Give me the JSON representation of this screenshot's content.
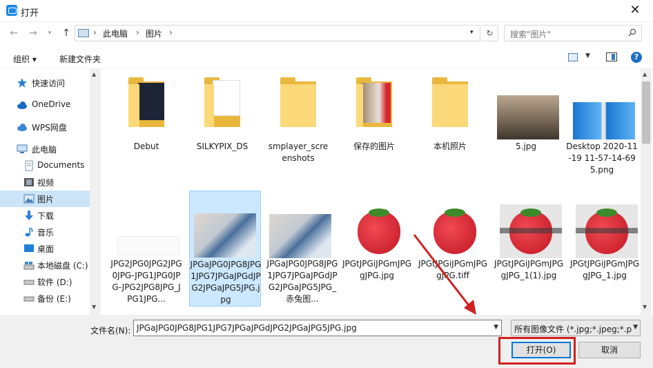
{
  "window": {
    "title": "打开"
  },
  "address": {
    "crumbs": [
      "此电脑",
      "图片"
    ],
    "search_placeholder": "搜索\"图片\""
  },
  "toolbar": {
    "organize": "组织 ▾",
    "new_folder": "新建文件夹"
  },
  "nav": {
    "items": [
      {
        "label": "快速访问",
        "icon": "star-icon"
      },
      {
        "label": "OneDrive",
        "icon": "cloud-icon"
      },
      {
        "label": "WPS网盘",
        "icon": "cloud-icon"
      },
      {
        "label": "此电脑",
        "icon": "computer-icon"
      },
      {
        "label": "Documents",
        "icon": "document-icon"
      },
      {
        "label": "视频",
        "icon": "video-icon"
      },
      {
        "label": "图片",
        "icon": "picture-icon"
      },
      {
        "label": "下载",
        "icon": "download-icon"
      },
      {
        "label": "音乐",
        "icon": "music-icon"
      },
      {
        "label": "桌面",
        "icon": "desktop-icon"
      },
      {
        "label": "本地磁盘 (C:)",
        "icon": "drive-icon"
      },
      {
        "label": "软件 (D:)",
        "icon": "drive-icon"
      },
      {
        "label": "备份 (E:)",
        "icon": "drive-icon"
      }
    ],
    "selected_index": 6
  },
  "files": {
    "row1": [
      {
        "label": "Debut",
        "kind": "folder"
      },
      {
        "label": "SILKYPIX_DS",
        "kind": "folder"
      },
      {
        "label": "smplayer_screenshots",
        "kind": "folder"
      },
      {
        "label": "保存的图片",
        "kind": "folder"
      },
      {
        "label": "本机照片",
        "kind": "folder"
      },
      {
        "label": "5.jpg",
        "kind": "image"
      },
      {
        "label": "Desktop 2020-11-19 11-57-14-695.png",
        "kind": "image"
      }
    ],
    "row2": [
      {
        "label": "JPG2JPG0JPG2JPG0JPG-JPG1JPG0JPG-JPG2JPG8JPG_JPG1JPG...",
        "kind": "image"
      },
      {
        "label": "JPGaJPG0JPG8JPG1JPG7JPGaJPGdJPG2JPGaJPG5JPG.jpg",
        "kind": "image",
        "selected": true
      },
      {
        "label": "JPGaJPG0JPG8JPG1JPG7JPGaJPGdJPG2JPGaJPG5JPG_赤兔图...",
        "kind": "image"
      },
      {
        "label": "JPGtJPGiJPGmJPGgJPG.jpg",
        "kind": "image"
      },
      {
        "label": "JPGtJPGiJPGmJPGgJPG.tiff",
        "kind": "image"
      },
      {
        "label": "JPGtJPGiJPGmJPGgJPG_1(1).jpg",
        "kind": "image"
      },
      {
        "label": "JPGtJPGiJPGmJPGgJPG_1.jpg",
        "kind": "image"
      }
    ]
  },
  "bottom": {
    "filename_label": "文件名(N):",
    "filename_value": "JPGaJPG0JPG8JPG1JPG7JPGaJPGdJPG2JPGaJPG5JPG.jpg",
    "filter_value": "所有图像文件 (*.jpg;*.jpeg;*.p",
    "open_label": "打开(O)",
    "cancel_label": "取消"
  },
  "colors": {
    "accent": "#0078d7",
    "selected_bg": "#cce8ff",
    "highlight_red": "#d21f1f"
  }
}
